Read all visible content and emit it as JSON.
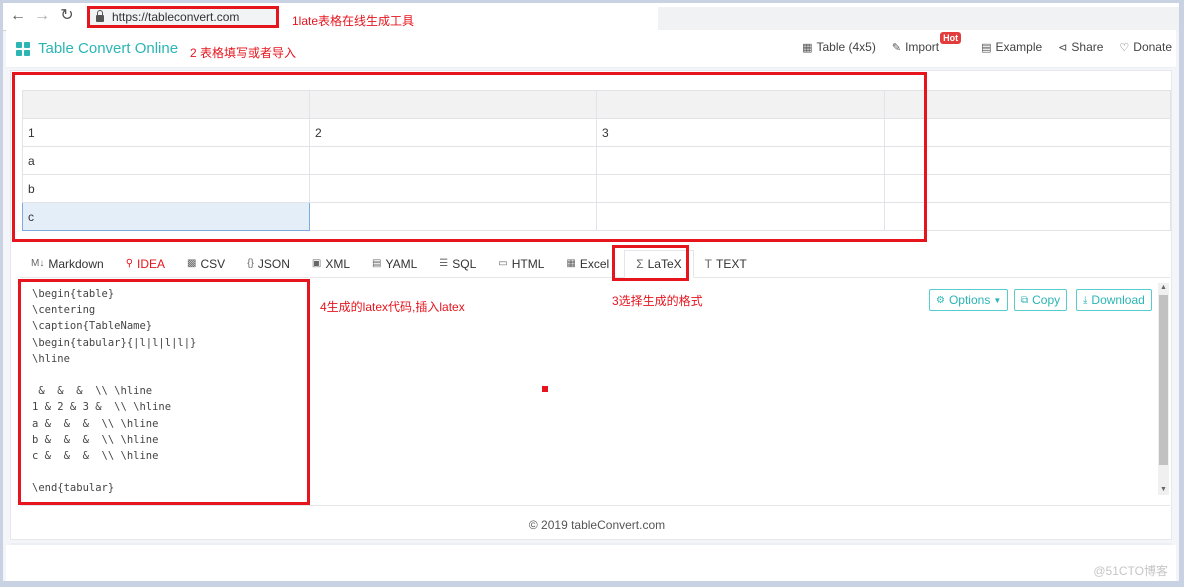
{
  "browser": {
    "back_icon": "arrow-left-icon",
    "forward_icon": "arrow-right-icon",
    "reload_icon": "reload-icon",
    "url": "https://tableconvert.com"
  },
  "annotations": {
    "step1": "1late表格在线生成工具",
    "step2": "2 表格填写或者导入",
    "step3": "3选择生成的格式",
    "step4": "4生成的latex代码,插入latex"
  },
  "header": {
    "brand": "Table Convert Online",
    "menu": [
      {
        "icon": "table-grid-icon",
        "label": "Table (4x5)"
      },
      {
        "icon": "import-edit-icon",
        "label": "Import",
        "badge": "Hot"
      },
      {
        "icon": "example-icon",
        "label": "Example"
      },
      {
        "icon": "share-icon",
        "label": "Share"
      },
      {
        "icon": "heart-icon",
        "label": "Donate"
      }
    ]
  },
  "table": {
    "header": [
      "",
      "",
      "",
      ""
    ],
    "rows": [
      [
        "1",
        "2",
        "3",
        ""
      ],
      [
        "a",
        "",
        "",
        ""
      ],
      [
        "b",
        "",
        "",
        ""
      ],
      [
        "c",
        "",
        "",
        ""
      ]
    ],
    "active_cell": "c"
  },
  "format_tabs": [
    {
      "icon": "markdown-icon",
      "label": "Markdown"
    },
    {
      "icon": "lightbulb-icon",
      "label": "IDEA"
    },
    {
      "icon": "csv-icon",
      "label": "CSV"
    },
    {
      "icon": "json-braces-icon",
      "label": "JSON"
    },
    {
      "icon": "xml-icon",
      "label": "XML"
    },
    {
      "icon": "yaml-icon",
      "label": "YAML"
    },
    {
      "icon": "database-icon",
      "label": "SQL"
    },
    {
      "icon": "html-icon",
      "label": "HTML"
    },
    {
      "icon": "excel-icon",
      "label": "Excel"
    },
    {
      "icon": "sigma-icon",
      "label": "LaTeX",
      "active": true
    },
    {
      "icon": "text-t-icon",
      "label": "TEXT"
    }
  ],
  "output": {
    "code": "\\begin{table}\n\\centering\n\\caption{TableName}\n\\begin{tabular}{|l|l|l|l|}\n\\hline\n\n &  &  &  \\\\ \\hline\n1 & 2 & 3 &  \\\\ \\hline\na &  &  &  \\\\ \\hline\nb &  &  &  \\\\ \\hline\nc &  &  &  \\\\ \\hline\n\n\\end{tabular}",
    "options_label": "Options",
    "copy_label": "Copy",
    "download_label": "Download"
  },
  "footer": {
    "copyright": "© 2019 tableConvert.com"
  },
  "watermark": "@51CTO博客",
  "colors": {
    "accent": "#2bb5b5",
    "annotation_red": "#e5141d",
    "hot_badge": "#e23c3c",
    "active_cell": "#e4eef8"
  }
}
